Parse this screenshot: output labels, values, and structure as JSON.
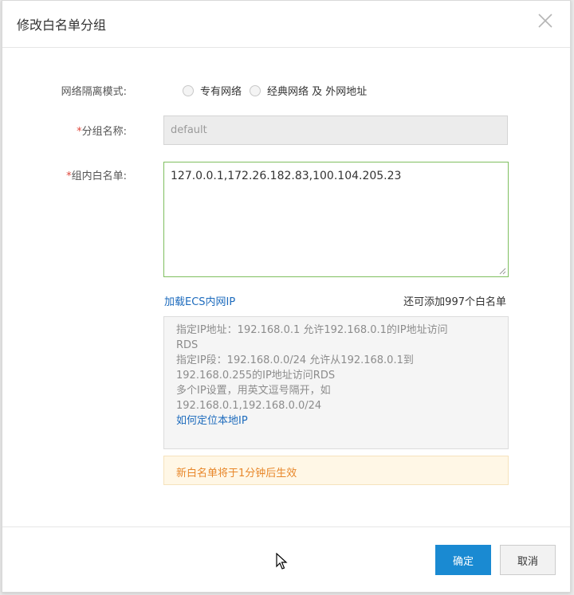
{
  "dialog": {
    "title": "修改白名单分组",
    "close_icon": "close-icon"
  },
  "form": {
    "network_mode": {
      "label": "网络隔离模式:",
      "options": [
        "专有网络",
        "经典网络 及 外网地址"
      ]
    },
    "group_name": {
      "required_mark": "*",
      "label": "分组名称:",
      "value": "default"
    },
    "whitelist": {
      "required_mark": "*",
      "label": "组内白名单:",
      "value": "127.0.0.1,172.26.182.83,100.104.205.23"
    },
    "load_link": "加载ECS内网IP",
    "remaining": "还可添加997个白名单",
    "hint_lines": [
      "指定IP地址：192.168.0.1 允许192.168.0.1的IP地址访问",
      "RDS",
      "指定IP段：192.168.0.0/24 允许从192.168.0.1到",
      "192.168.0.255的IP地址访问RDS",
      "多个IP设置，用英文逗号隔开，如",
      "192.168.0.1,192.168.0.0/24"
    ],
    "hint_link": "如何定位本地IP",
    "warning": "新白名单将于1分钟后生效"
  },
  "footer": {
    "confirm_label": "确定",
    "cancel_label": "取消"
  },
  "colors": {
    "primary": "#1a8ad2",
    "link": "#1d6bbd",
    "required": "#e0483c",
    "warning_text": "#e8872a",
    "focus_border": "#7fbf5f"
  }
}
